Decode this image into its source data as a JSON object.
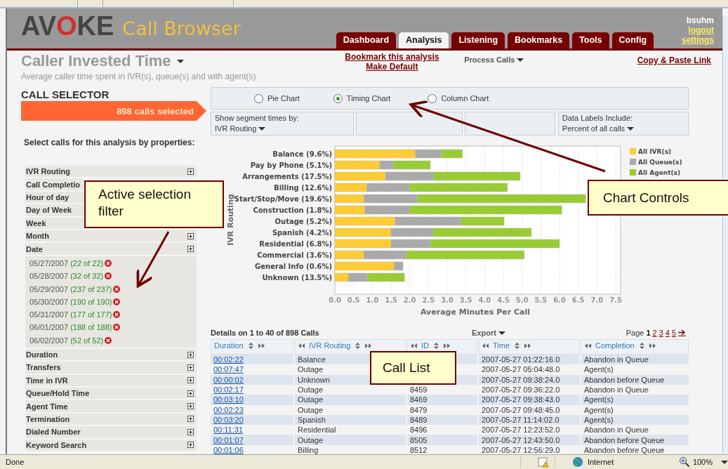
{
  "header": {
    "logo": "AVOKE",
    "product": "Call Browser",
    "user": "bsuhm",
    "user_links": [
      "logout",
      "settings"
    ]
  },
  "tabs": [
    {
      "label": "Dashboard",
      "selected": false
    },
    {
      "label": "Analysis",
      "selected": true
    },
    {
      "label": "Listening",
      "selected": false
    },
    {
      "label": "Bookmarks",
      "selected": false
    },
    {
      "label": "Tools",
      "selected": false
    },
    {
      "label": "Config",
      "selected": false
    }
  ],
  "analysis": {
    "title": "Caller Invested Time",
    "subtitle": "Average caller time spent in IVR(s), queue(s) and with agent(s)",
    "links": [
      "Bookmark this analysis",
      "Make Default"
    ],
    "process_menu": "Process Calls",
    "copy_link": "Copy & Paste Link"
  },
  "call_selector": {
    "title": "CALL SELECTOR",
    "count": "898 calls selected",
    "prompt": "Select calls for this analysis by properties:",
    "filters": [
      {
        "label": "IVR Routing",
        "expandable": true
      },
      {
        "label": "Call Completio",
        "expandable": false
      },
      {
        "label": "Hour of day",
        "expandable": false
      },
      {
        "label": "Day of Week",
        "expandable": false
      },
      {
        "label": "Week",
        "expandable": false
      },
      {
        "label": "Month",
        "expandable": true
      },
      {
        "label": "Date",
        "expandable": true,
        "children": [
          {
            "value": "05/27/2007",
            "count": "(22 of 22)"
          },
          {
            "value": "05/28/2007",
            "count": "(32 of 32)"
          },
          {
            "value": "05/29/2007",
            "count": "(237 of 237)"
          },
          {
            "value": "05/30/2007",
            "count": "(190 of 190)"
          },
          {
            "value": "05/31/2007",
            "count": "(177 of 177)"
          },
          {
            "value": "06/01/2007",
            "count": "(188 of 188)"
          },
          {
            "value": "06/02/2007",
            "count": "(52 of 52)"
          }
        ]
      },
      {
        "label": "Duration",
        "expandable": true
      },
      {
        "label": "Transfers",
        "expandable": true
      },
      {
        "label": "Time in IVR",
        "expandable": true
      },
      {
        "label": "Queue/Hold Time",
        "expandable": true
      },
      {
        "label": "Agent Time",
        "expandable": true
      },
      {
        "label": "Termination",
        "expandable": true
      },
      {
        "label": "Dialed Number",
        "expandable": true
      },
      {
        "label": "Keyword Search",
        "expandable": true
      }
    ]
  },
  "chart_types": [
    {
      "label": "Pie Chart",
      "selected": false
    },
    {
      "label": "Timing Chart",
      "selected": true
    },
    {
      "label": "Column Chart",
      "selected": false
    }
  ],
  "chart_options": [
    {
      "kind": "select",
      "label": "Show segment times by:",
      "value": "IVR Routing"
    },
    {
      "kind": "blank"
    },
    {
      "kind": "blank"
    },
    {
      "kind": "select",
      "label": "Data Labels Include:",
      "value": "Percent of all calls"
    }
  ],
  "chart": {
    "chart_data": {
      "type": "bar",
      "orientation": "horizontal",
      "stacked": true,
      "grid": true,
      "legend": true,
      "xlabel": "Average Minutes Per Call",
      "ylabel": "IVR Routing",
      "categories": [
        "Balance (9.6%)",
        "Pay by Phone (5.1%)",
        "Arrangements (17.5%)",
        "Billing (12.6%)",
        "Start/Stop/Move (19.6%)",
        "Construction (1.8%)",
        "Outage (5.2%)",
        "Spanish (4.2%)",
        "Residential (6.8%)",
        "Commercial (3.6%)",
        "General Info (0.6%)",
        "Unknown (13.5%)"
      ],
      "series": [
        {
          "name": "All IVR(s)",
          "color": "#ffcc33",
          "values": [
            2.15,
            1.2,
            1.35,
            0.85,
            0.78,
            0.8,
            1.61,
            1.5,
            1.5,
            0.77,
            1.58,
            0.36
          ]
        },
        {
          "name": "All Queue(s)",
          "color": "#aaaaaa",
          "values": [
            0.68,
            0.36,
            1.28,
            1.14,
            1.41,
            1.2,
            1.75,
            1.11,
            1.05,
            1.14,
            0.24,
            0.5
          ]
        },
        {
          "name": "All Agent(s)",
          "color": "#99cc33",
          "values": [
            0.58,
            0.99,
            2.32,
            2.62,
            4.51,
            4.06,
            1.16,
            2.64,
            3.45,
            3.15,
            0,
            1.0
          ]
        }
      ],
      "xlim": [
        0,
        7.5
      ],
      "xticks": [
        {
          "value": 0,
          "label": "0.0"
        },
        {
          "value": 0.5,
          "label": "0.5"
        },
        {
          "value": 1,
          "label": "1.0"
        },
        {
          "value": 1.5,
          "label": "1.5"
        },
        {
          "value": 2,
          "label": "2.0"
        },
        {
          "value": 2.5,
          "label": "2.5"
        },
        {
          "value": 3,
          "label": "3.0"
        },
        {
          "value": 3.5,
          "label": "3.5"
        },
        {
          "value": 4,
          "label": "4.0"
        },
        {
          "value": 4.5,
          "label": "4.5"
        },
        {
          "value": 5,
          "label": "5.0"
        },
        {
          "value": 5.5,
          "label": "5.5"
        },
        {
          "value": 6,
          "label": "6.0"
        },
        {
          "value": 6.5,
          "label": "6.5"
        },
        {
          "value": 7,
          "label": "7.0"
        },
        {
          "value": 7.5,
          "label": "7.5"
        }
      ]
    }
  },
  "details": {
    "summary": "Details on **1** to **40** of **898** Calls",
    "export": "Export",
    "page_label": "Page",
    "pages": [
      {
        "label": "1",
        "selected": true
      },
      {
        "label": "2",
        "selected": false
      },
      {
        "label": "3",
        "selected": false
      },
      {
        "label": "4",
        "selected": false
      },
      {
        "label": "5",
        "selected": false
      }
    ]
  },
  "table": {
    "columns": [
      {
        "label": "Duration",
        "move_left": false
      },
      {
        "label": "IVR Routing",
        "move_left": true
      },
      {
        "label": "ID",
        "move_left": true
      },
      {
        "label": "Time",
        "move_left": true
      },
      {
        "label": "Completion",
        "move_left": true
      }
    ],
    "rows": [
      [
        "00:02:22",
        "Balance",
        null,
        "2007-05-27 01:22:16.0",
        "Abandon in Queue"
      ],
      [
        "00:07:47",
        "Outage",
        null,
        "2007-05-27 05:04:48.0",
        "Agent(s)"
      ],
      [
        "00:00:02",
        "Unknown",
        null,
        "2007-05-27 09:38:24.0",
        "Abandon before Queue"
      ],
      [
        "00:02:17",
        "Outage",
        "8459",
        "2007-05-27 09:36:22.0",
        "Abandon in Queue"
      ],
      [
        "00:03:10",
        "Outage",
        "8469",
        "2007-05-27 09:38:43.0",
        "Agent(s)"
      ],
      [
        "00:02:23",
        "Outage",
        "8479",
        "2007-05-27 09:48:45.0",
        "Agent(s)"
      ],
      [
        "00:03:20",
        "Spanish",
        "8489",
        "2007-05-27 11:14:02.0",
        "Agent(s)"
      ],
      [
        "00:11:31",
        "Residential",
        "8496",
        "2007-05-27 12:23:52.0",
        "Abandon in Queue"
      ],
      [
        "00:01:07",
        "Outage",
        "8505",
        "2007-05-27 12:43:50.0",
        "Abandon before Queue"
      ],
      [
        "00:01:06",
        "Billing",
        "8512",
        "2007-05-27 12:56:29.0",
        "Abandon before Queue"
      ]
    ]
  },
  "annotations": [
    {
      "text": "Active  selection filter"
    },
    {
      "text": "Chart Controls"
    },
    {
      "text": "Call List"
    }
  ],
  "status_bar": {
    "status": "Done",
    "zone": "Internet",
    "zoom": "100%"
  }
}
